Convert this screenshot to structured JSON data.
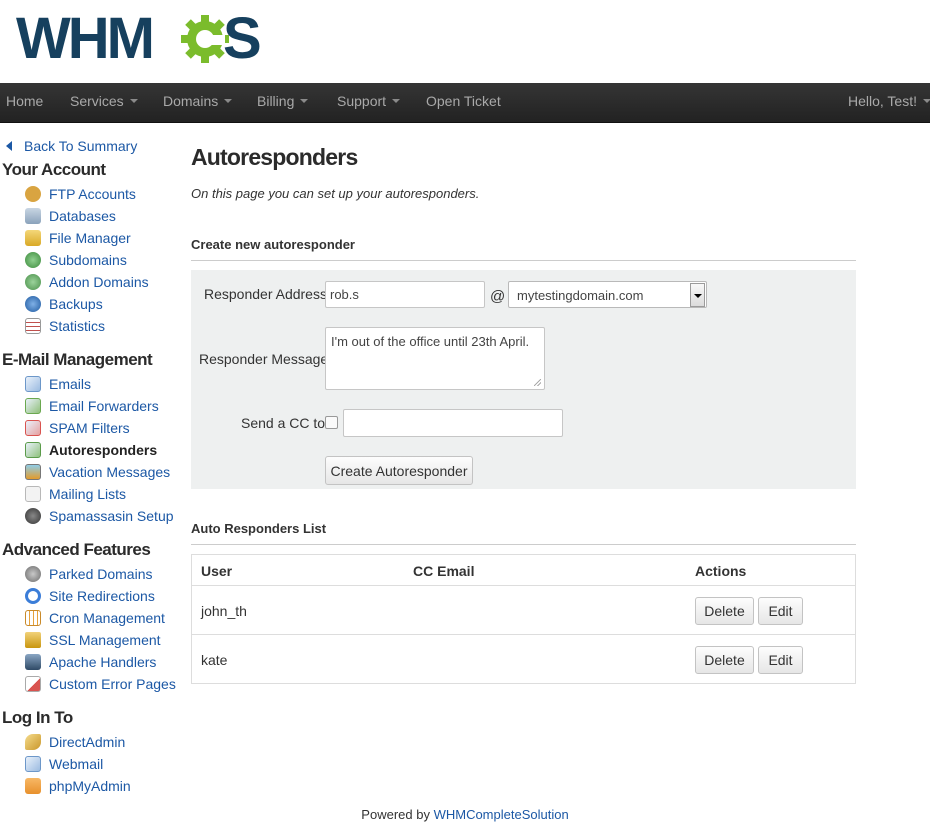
{
  "brand": {
    "logo_text": "WHMCS",
    "accent": "#7bbc2c",
    "dark": "#16405e"
  },
  "nav": {
    "items": [
      {
        "label": "Home",
        "dropdown": false
      },
      {
        "label": "Services",
        "dropdown": true
      },
      {
        "label": "Domains",
        "dropdown": true
      },
      {
        "label": "Billing",
        "dropdown": true
      },
      {
        "label": "Support",
        "dropdown": true
      },
      {
        "label": "Open Ticket",
        "dropdown": false
      }
    ],
    "user_label": "Hello, Test!"
  },
  "sidebar": {
    "back_label": "Back To Summary",
    "sections": [
      {
        "title": "Your Account",
        "items": [
          {
            "label": "FTP Accounts",
            "icon": "ftp-accounts-icon",
            "color": "#d9a441"
          },
          {
            "label": "Databases",
            "icon": "databases-icon",
            "color": "#9fb3c8"
          },
          {
            "label": "File Manager",
            "icon": "file-manager-icon",
            "color": "#e8c24d"
          },
          {
            "label": "Subdomains",
            "icon": "subdomains-icon",
            "color": "#4e9e4e"
          },
          {
            "label": "Addon Domains",
            "icon": "addon-domains-icon",
            "color": "#5aa05a"
          },
          {
            "label": "Backups",
            "icon": "backups-icon",
            "color": "#2e6fb7"
          },
          {
            "label": "Statistics",
            "icon": "statistics-icon",
            "color": "#c0504d"
          }
        ]
      },
      {
        "title": "E-Mail Management",
        "items": [
          {
            "label": "Emails",
            "icon": "emails-icon",
            "color": "#6c97c9"
          },
          {
            "label": "Email Forwarders",
            "icon": "email-forwarders-icon",
            "color": "#6aa84f"
          },
          {
            "label": "SPAM Filters",
            "icon": "spam-filters-icon",
            "color": "#d9534f"
          },
          {
            "label": "Autoresponders",
            "icon": "autoresponders-icon",
            "color": "#5b9b4a"
          },
          {
            "label": "Vacation Messages",
            "icon": "vacation-messages-icon",
            "color": "#e39b2b"
          },
          {
            "label": "Mailing Lists",
            "icon": "mailing-lists-icon",
            "color": "#b8b8b8"
          },
          {
            "label": "Spamassasin Setup",
            "icon": "spamassasin-setup-icon",
            "color": "#555555"
          }
        ]
      },
      {
        "title": "Advanced Features",
        "items": [
          {
            "label": "Parked Domains",
            "icon": "parked-domains-icon",
            "color": "#8a8a8a"
          },
          {
            "label": "Site Redirections",
            "icon": "site-redirections-icon",
            "color": "#3b7dd8"
          },
          {
            "label": "Cron Management",
            "icon": "cron-management-icon",
            "color": "#e6a23c"
          },
          {
            "label": "SSL Management",
            "icon": "ssl-management-icon",
            "color": "#d4a017"
          },
          {
            "label": "Apache Handlers",
            "icon": "apache-handlers-icon",
            "color": "#4a6a8a"
          },
          {
            "label": "Custom Error Pages",
            "icon": "custom-error-pages-icon",
            "color": "#d9534f"
          }
        ]
      },
      {
        "title": "Log In To",
        "items": [
          {
            "label": "DirectAdmin",
            "icon": "directadmin-icon",
            "color": "#e0b44a"
          },
          {
            "label": "Webmail",
            "icon": "webmail-icon",
            "color": "#6c97c9"
          },
          {
            "label": "phpMyAdmin",
            "icon": "phpmyadmin-icon",
            "color": "#e8902c"
          }
        ]
      }
    ],
    "active_item": "Autoresponders"
  },
  "main": {
    "title": "Autoresponders",
    "intro": "On this page you can set up your autoresponders.",
    "create_section": {
      "title": "Create new autoresponder",
      "address_label": "Responder Address",
      "address_value": "rob.s",
      "at_sign": "@",
      "domain_value": "mytestingdomain.com",
      "message_label": "Responder Message",
      "message_value": "I'm out of the office until 23th April.",
      "cc_label": "Send a CC to",
      "cc_checked": false,
      "cc_value": "",
      "submit_label": "Create Autoresponder"
    },
    "list_section": {
      "title": "Auto Responders List",
      "columns": [
        "User",
        "CC Email",
        "Actions"
      ],
      "rows": [
        {
          "user": "john_th",
          "cc": ""
        },
        {
          "user": "kate",
          "cc": ""
        }
      ],
      "delete_label": "Delete",
      "edit_label": "Edit"
    }
  },
  "footer": {
    "prefix": "Powered by",
    "link": "WHMCompleteSolution"
  }
}
